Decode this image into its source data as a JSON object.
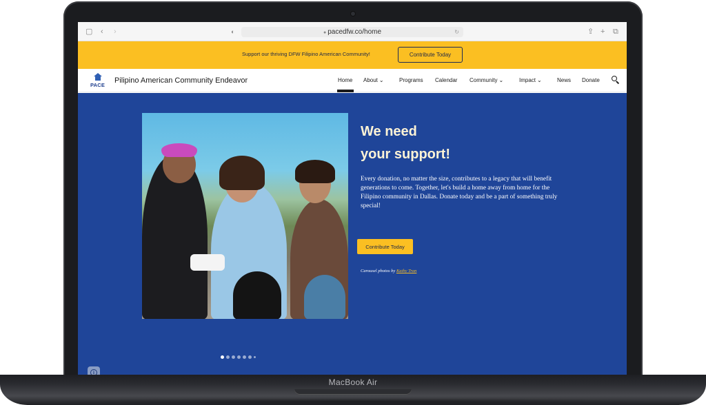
{
  "device": {
    "label": "MacBook Air"
  },
  "browser": {
    "url": "pacedfw.co/home",
    "icons": [
      "sidebar-icon",
      "back-icon",
      "forward-icon",
      "shield-icon",
      "lock-icon",
      "reload-icon",
      "share-icon",
      "new-tab-icon",
      "tabs-icon"
    ]
  },
  "announcement": {
    "text": "Support our thriving DFW Filipino American Community!",
    "button_label": "Contribute Today"
  },
  "nav": {
    "logo_text": "PACE",
    "site_name": "Pilipino American Community Endeavor",
    "items": [
      {
        "label": "Home",
        "active": true
      },
      {
        "label": "About",
        "dropdown": true
      },
      {
        "label": "Programs"
      },
      {
        "label": "Calendar"
      },
      {
        "label": "Community",
        "dropdown": true
      },
      {
        "label": "Impact",
        "dropdown": true
      },
      {
        "label": "News"
      },
      {
        "label": "Donate"
      }
    ],
    "chevron": "⌄",
    "search_icon": "search-icon"
  },
  "hero": {
    "title_line1": "We need",
    "title_line2": "your support!",
    "body": "Every donation, no matter the size, contributes to a legacy that will benefit generations to come. Together, let's build a home away from home for the Filipino community in Dallas. Donate today and be a part of something truly special!",
    "button_label": "Contribute Today",
    "credit_prefix": "Carousel photos by",
    "credit_name": "Kathy Tran",
    "carousel": {
      "total": 7,
      "active": 1
    }
  },
  "colors": {
    "accent": "#fbbf22",
    "hero_bg": "#1f4599",
    "brand_navy": "#1e2748"
  }
}
